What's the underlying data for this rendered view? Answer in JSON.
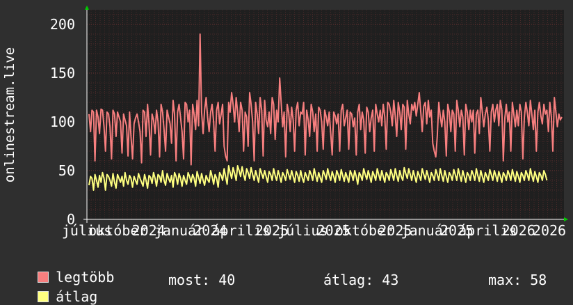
{
  "colors": {
    "background": "#2f2f2f",
    "plot_background": "#1f1f1f",
    "grid_minor": "#4a2a2a",
    "grid_major": "#6a3030",
    "axis": "#ffffff",
    "arrow": "#00cc00",
    "series_max": "#f77f7f",
    "series_avg": "#ffff80"
  },
  "chart_data": {
    "type": "line",
    "ylabel": "onlinestream.live",
    "ylim": [
      0,
      215
    ],
    "yticks": [
      0,
      50,
      100,
      150,
      200
    ],
    "grid": true,
    "x_tick_labels": [
      "július",
      "október",
      "2024",
      "január",
      "2024",
      "április",
      "2025",
      "július",
      "2025",
      "október",
      "2025",
      "január",
      "2025",
      "április",
      "2026",
      "2026"
    ],
    "series": [
      {
        "name": "legtöbb",
        "color": "#f77f7f",
        "values": [
          108,
          90,
          112,
          110,
          60,
          112,
          105,
          88,
          113,
          112,
          95,
          70,
          110,
          108,
          95,
          62,
          112,
          108,
          85,
          110,
          105,
          100,
          68,
          108,
          102,
          96,
          65,
          110,
          85,
          62,
          98,
          104,
          108,
          100,
          90,
          58,
          112,
          110,
          85,
          118,
          98,
          66,
          108,
          102,
          88,
          112,
          100,
          64,
          118,
          110,
          92,
          70,
          112,
          105,
          98,
          78,
          122,
          108,
          60,
          110,
          118,
          104,
          90,
          62,
          120,
          118,
          100,
          112,
          56,
          118,
          108,
          92,
          122,
          96,
          190,
          110,
          88,
          112,
          125,
          105,
          90,
          110,
          118,
          100,
          70,
          112,
          120,
          98,
          108,
          118,
          75,
          65,
          60,
          120,
          110,
          130,
          118,
          100,
          125,
          110,
          90,
          120,
          112,
          70,
          110,
          105,
          75,
          130,
          118,
          100,
          60,
          120,
          108,
          88,
          125,
          112,
          65,
          122,
          102,
          95,
          110,
          88,
          125,
          118,
          82,
          112,
          100,
          145,
          120,
          95,
          110,
          64,
          118,
          110,
          90,
          115,
          102,
          70,
          112,
          120,
          96,
          110,
          108,
          120,
          66,
          112,
          102,
          85,
          118,
          110,
          90,
          108,
          70,
          115,
          112,
          100,
          72,
          112,
          105,
          96,
          110,
          88,
          66,
          110,
          106,
          98,
          108,
          70,
          112,
          118,
          96,
          104,
          112,
          72,
          110,
          108,
          95,
          104,
          66,
          110,
          118,
          92,
          110,
          102,
          68,
          115,
          110,
          90,
          104,
          112,
          70,
          118,
          108,
          100,
          112,
          96,
          118,
          105,
          72,
          120,
          118,
          110,
          96,
          122,
          106,
          85,
          120,
          110,
          92,
          118,
          115,
          72,
          122,
          108,
          98,
          118,
          112,
          120,
          106,
          118,
          130,
          110,
          90,
          116,
          120,
          98,
          122,
          105,
          112,
          78,
          70,
          64,
          85,
          120,
          106,
          95,
          112,
          100,
          65,
          118,
          110,
          90,
          112,
          108,
          70,
          122,
          112,
          95,
          112,
          105,
          66,
          118,
          110,
          92,
          112,
          100,
          112,
          68,
          108,
          112,
          88,
          125,
          110,
          95,
          108,
          115,
          102,
          70,
          110,
          118,
          100,
          112,
          118,
          96,
          122,
          112,
          60,
          104,
          118,
          100,
          110,
          70,
          120,
          108,
          95,
          112,
          96,
          118,
          110,
          62,
          104,
          120,
          110,
          96,
          122,
          108,
          92,
          112,
          70,
          110,
          120,
          106,
          98,
          118,
          108,
          112,
          90,
          120,
          105,
          70,
          125,
          110,
          95,
          108,
          102,
          105
        ]
      },
      {
        "name": "átlag",
        "color": "#ffff80",
        "values": [
          35,
          44,
          42,
          30,
          46,
          40,
          33,
          45,
          38,
          48,
          42,
          30,
          46,
          44,
          40,
          34,
          47,
          38,
          32,
          46,
          42,
          38,
          44,
          34,
          48,
          40,
          36,
          45,
          42,
          33,
          44,
          40,
          36,
          47,
          42,
          38,
          34,
          46,
          40,
          32,
          45,
          43,
          37,
          48,
          42,
          34,
          46,
          44,
          38,
          50,
          40,
          35,
          47,
          42,
          38,
          45,
          33,
          48,
          44,
          36,
          47,
          42,
          34,
          45,
          40,
          36,
          48,
          44,
          38,
          46,
          42,
          34,
          49,
          43,
          37,
          47,
          40,
          35,
          45,
          41,
          38,
          50,
          44,
          36,
          46,
          42,
          33,
          48,
          45,
          40,
          52,
          44,
          36,
          55,
          48,
          42,
          53,
          47,
          40,
          55,
          50,
          44,
          54,
          46,
          40,
          52,
          48,
          42,
          53,
          46,
          40,
          50,
          44,
          38,
          52,
          47,
          42,
          50,
          44,
          38,
          49,
          46,
          40,
          52,
          45,
          40,
          50,
          44,
          38,
          48,
          45,
          40,
          51,
          46,
          41,
          50,
          44,
          38,
          49,
          45,
          39,
          50,
          43,
          38,
          48,
          44,
          40,
          50,
          46,
          40,
          52,
          45,
          39,
          48,
          43,
          38,
          50,
          46,
          41,
          52,
          45,
          40,
          49,
          44,
          38,
          50,
          46,
          40,
          51,
          45,
          39,
          48,
          43,
          38,
          50,
          46,
          40,
          50,
          44,
          36,
          48,
          45,
          40,
          52,
          46,
          41,
          50,
          44,
          38,
          49,
          45,
          40,
          52,
          46,
          40,
          50,
          44,
          38,
          48,
          45,
          40,
          51,
          46,
          40,
          52,
          45,
          39,
          50,
          44,
          40,
          53,
          47,
          42,
          52,
          46,
          40,
          50,
          44,
          38,
          49,
          45,
          40,
          52,
          46,
          41,
          50,
          44,
          38,
          48,
          45,
          40,
          51,
          46,
          40,
          52,
          45,
          39,
          50,
          44,
          38,
          48,
          45,
          40,
          51,
          46,
          40,
          52,
          45,
          39,
          50,
          44,
          38,
          48,
          45,
          40,
          50,
          46,
          40,
          52,
          45,
          39,
          50,
          44,
          38,
          48,
          44,
          40,
          51,
          46,
          40,
          50,
          45,
          39,
          49,
          44,
          38,
          48,
          45,
          40,
          50,
          46,
          40,
          51,
          45,
          39,
          49,
          44,
          38,
          48,
          45,
          40,
          50,
          46,
          40,
          52,
          45,
          39,
          49,
          44,
          38,
          48,
          45,
          40,
          50,
          46,
          40
        ]
      }
    ]
  },
  "legend": {
    "items": [
      {
        "label": "legtöbb",
        "color": "#f77f7f"
      },
      {
        "label": "átlag",
        "color": "#ffff80"
      }
    ],
    "stats": {
      "now_label": "most:",
      "now_value": "40",
      "avg_label": "átlag:",
      "avg_value": "43",
      "max_label": "max:",
      "max_value": "58"
    }
  }
}
